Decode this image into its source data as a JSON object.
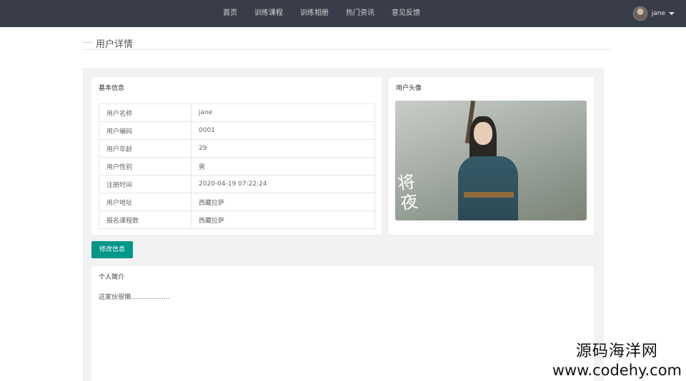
{
  "nav": {
    "items": [
      "首页",
      "训练课程",
      "训练相册",
      "热门资讯",
      "意见反馈"
    ]
  },
  "user": {
    "name": "jane"
  },
  "page": {
    "title": "用户详情"
  },
  "basic_info": {
    "title": "基本信息",
    "rows": [
      {
        "label": "用户名称",
        "value": "jane"
      },
      {
        "label": "用户编码",
        "value": "0001"
      },
      {
        "label": "用户年龄",
        "value": "29"
      },
      {
        "label": "用户性别",
        "value": "男"
      },
      {
        "label": "注册时间",
        "value": "2020-04-19 07:22:24"
      },
      {
        "label": "用户地址",
        "value": "西藏拉萨"
      },
      {
        "label": "报名课程数",
        "value": "西藏拉萨"
      }
    ]
  },
  "avatar_card": {
    "title": "用户头像",
    "photo_caption": "将夜"
  },
  "edit_button": {
    "label": "修改信息"
  },
  "intro": {
    "title": "个人简介",
    "text": "这家伙很懒..................."
  },
  "watermark": {
    "name": "源码海洋网",
    "url": "www.codehy.com"
  },
  "colors": {
    "topbar": "#393d49",
    "accent": "#009688",
    "panel_bg": "#f2f2f2"
  }
}
